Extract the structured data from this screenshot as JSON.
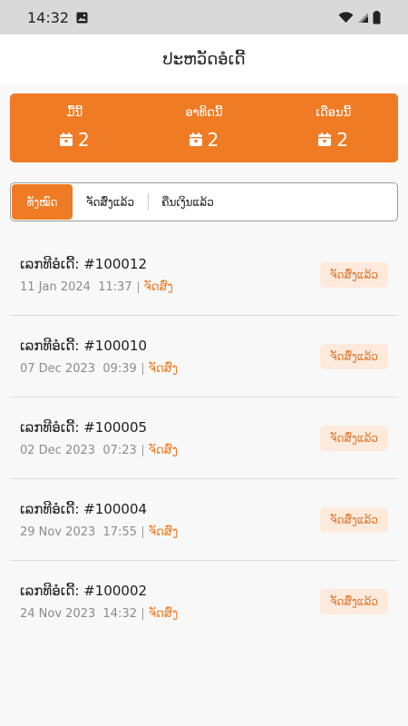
{
  "status_bar": {
    "time": "14:32",
    "icons": [
      "image-icon",
      "wifi-icon",
      "signal-icon",
      "battery-icon"
    ]
  },
  "header": {
    "title": "ປະຫວັດອໍເດີ້"
  },
  "summary": {
    "accent_color": "#ef7b24",
    "items": [
      {
        "label": "ມື້ນີ້",
        "count": "2",
        "icon": "calendar-icon"
      },
      {
        "label": "ອາທິດນີ້",
        "count": "2",
        "icon": "calendar-icon"
      },
      {
        "label": "ເດືອນນີ້",
        "count": "2",
        "icon": "calendar-icon"
      }
    ]
  },
  "tabs": {
    "items": [
      {
        "label": "ທັງໝົດ",
        "active": true
      },
      {
        "label": "ຈັດສົ່ງແລ້ວ",
        "active": false
      },
      {
        "label": "ຄືນເງິນແລ້ວ",
        "active": false
      }
    ]
  },
  "orders": [
    {
      "number": "ເລກທີອໍເດີ້: #100012",
      "date": "11 Jan 2024",
      "time": "11:37",
      "delivery": "ຈັດສົ່ງ",
      "status": "ຈັດສົ່ງແລ້ວ"
    },
    {
      "number": "ເລກທີອໍເດີ້: #100010",
      "date": "07 Dec 2023",
      "time": "09:39",
      "delivery": "ຈັດສົ່ງ",
      "status": "ຈັດສົ່ງແລ້ວ"
    },
    {
      "number": "ເລກທີອໍເດີ້: #100005",
      "date": "02 Dec 2023",
      "time": "07:23",
      "delivery": "ຈັດສົ່ງ",
      "status": "ຈັດສົ່ງແລ້ວ"
    },
    {
      "number": "ເລກທີອໍເດີ້: #100004",
      "date": "29 Nov 2023",
      "time": "17:55",
      "delivery": "ຈັດສົ່ງ",
      "status": "ຈັດສົ່ງແລ້ວ"
    },
    {
      "number": "ເລກທີອໍເດີ້: #100002",
      "date": "24 Nov 2023",
      "time": "14:32",
      "delivery": "ຈັດສົ່ງ",
      "status": "ຈັດສົ່ງແລ້ວ"
    }
  ]
}
